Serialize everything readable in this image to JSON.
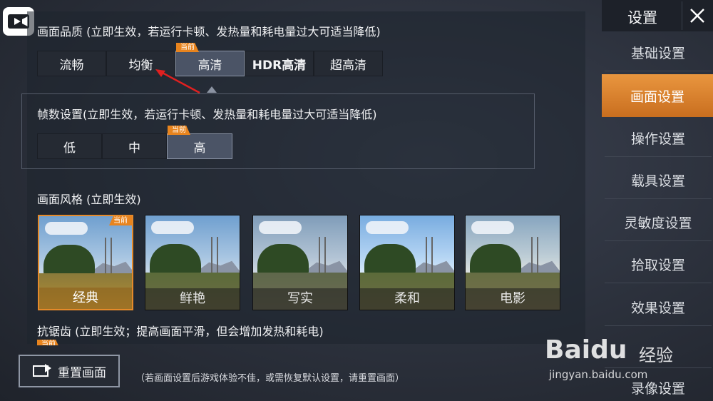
{
  "quality": {
    "title": "画面品质 (立即生效，若运行卡顿、发热量和耗电量过大可适当降低)",
    "current_badge": "当前",
    "options": [
      "流畅",
      "均衡",
      "高清",
      "HDR高清",
      "超高清"
    ],
    "selected": "高清"
  },
  "fps": {
    "title": "帧数设置(立即生效，若运行卡顿、发热量和耗电量过大可适当降低)",
    "current_badge": "当前",
    "options": [
      "低",
      "中",
      "高"
    ],
    "selected": "高"
  },
  "style": {
    "title": "画面风格 (立即生效)",
    "current_badge": "当前",
    "options": [
      "经典",
      "鲜艳",
      "写实",
      "柔和",
      "电影"
    ],
    "selected": "经典"
  },
  "antialias": {
    "title": "抗锯齿 (立即生效；提高画面平滑，但会增加发热和耗电)",
    "current_badge": "当前"
  },
  "reset": {
    "label": "重置画面",
    "hint": "（若画面设置后游戏体验不佳，或需恢复默认设置，请重置画面）"
  },
  "sidebar": {
    "title": "设置",
    "items": [
      "基础设置",
      "画面设置",
      "操作设置",
      "载具设置",
      "灵敏度设置",
      "拾取设置",
      "效果设置",
      "",
      "录像设置"
    ],
    "active": "画面设置"
  },
  "watermark": {
    "brand": "Baidu",
    "product": "经验",
    "url": "jingyan.baidu.com"
  },
  "icons": {
    "record": "video-camera-icon",
    "close": "close-icon",
    "reset": "reset-screen-icon"
  },
  "colors": {
    "accent": "#e8841e",
    "active_tab": "#d9822b"
  }
}
